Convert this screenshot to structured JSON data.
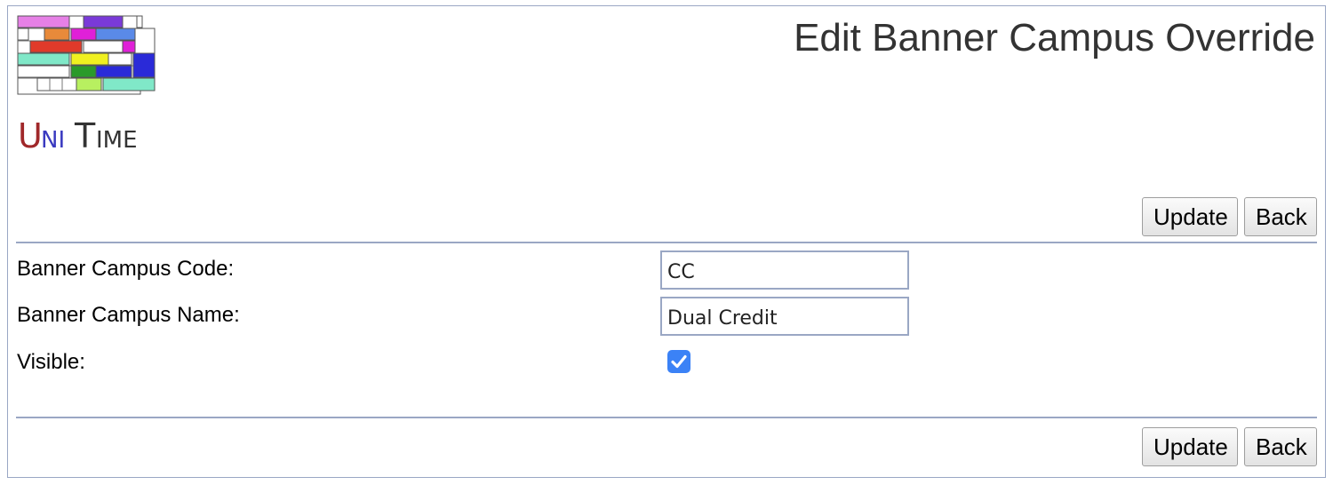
{
  "header": {
    "logo_text": "UniTime",
    "title": "Edit Banner Campus Override"
  },
  "toolbar_top": {
    "update_label": "Update",
    "back_label": "Back"
  },
  "form": {
    "campus_code": {
      "label": "Banner Campus Code:",
      "value": "CC"
    },
    "campus_name": {
      "label": "Banner Campus Name:",
      "value": "Dual Credit"
    },
    "visible": {
      "label": "Visible:",
      "checked": true
    }
  },
  "toolbar_bottom": {
    "update_label": "Update",
    "back_label": "Back"
  },
  "colors": {
    "border": "#9aa7c4",
    "checkbox": "#3b82f6",
    "title": "#333333",
    "logo_u": "#a0282a",
    "logo_ni": "#3a3ac0"
  },
  "icons": {
    "logo": "unitime-logo-icon",
    "check": "checkmark-icon"
  }
}
